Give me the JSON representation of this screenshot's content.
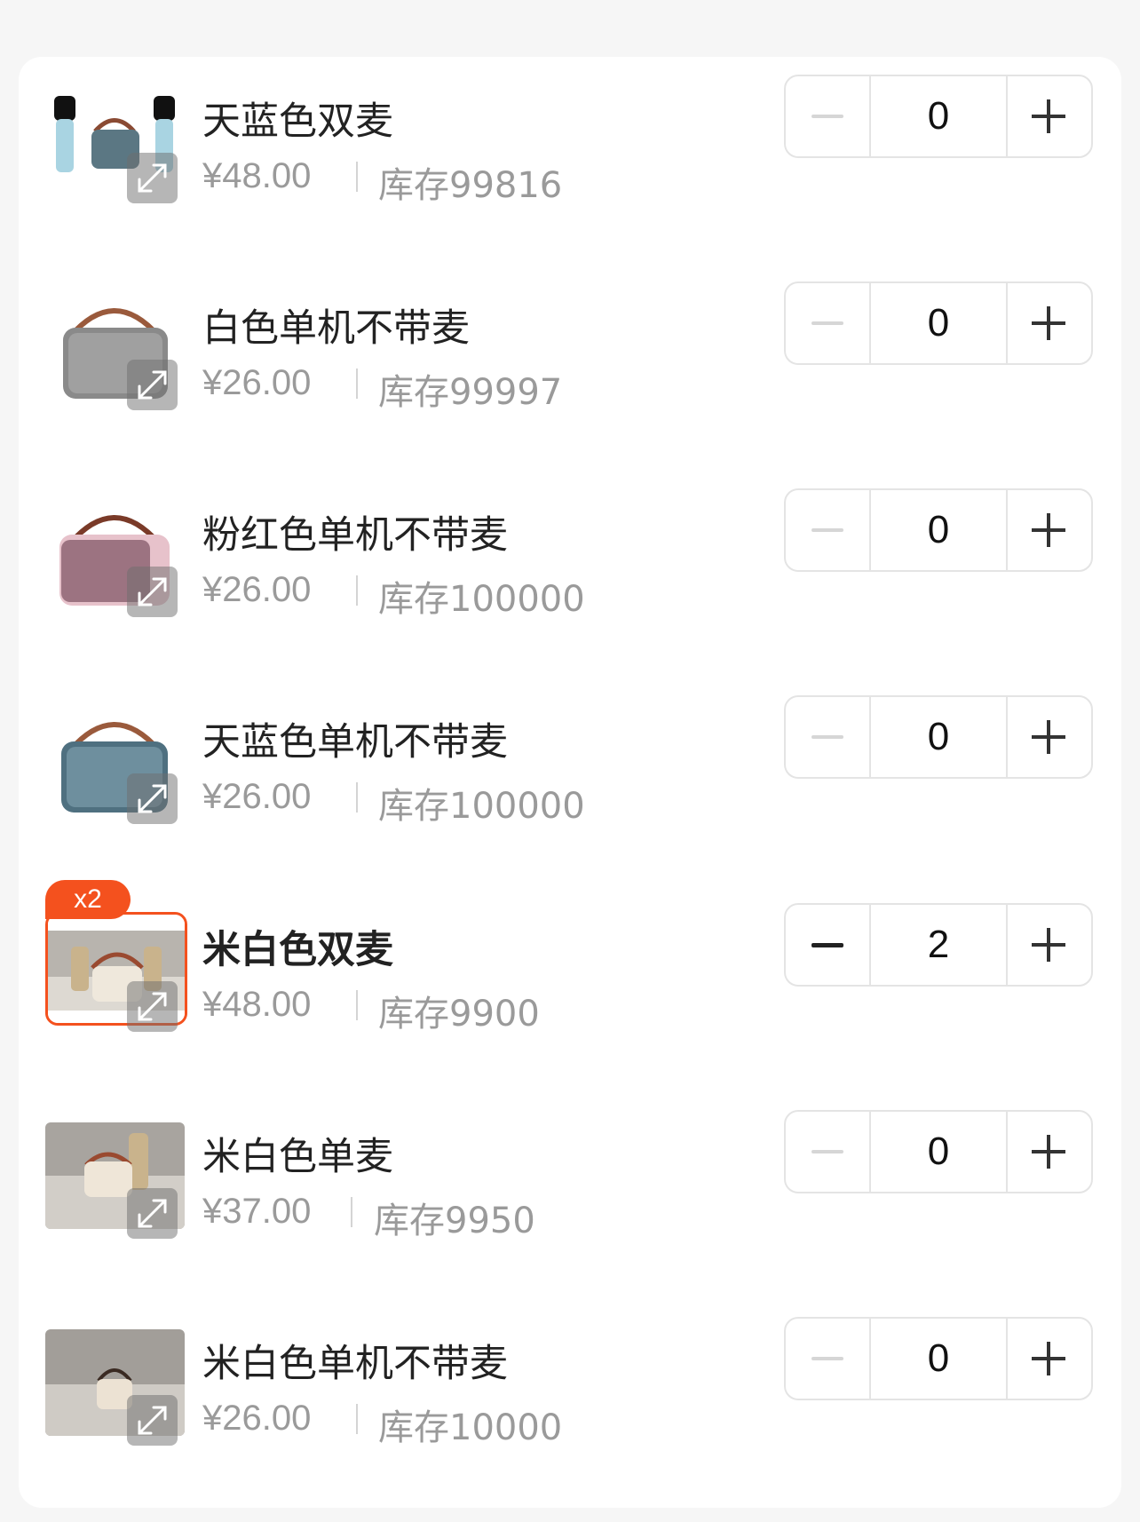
{
  "items": [
    {
      "name": "天蓝色双麦",
      "price": "¥48.00",
      "stock": "库存99816",
      "quantity": "0",
      "selected": false,
      "image": "blue-speaker-two-mics"
    },
    {
      "name": "白色单机不带麦",
      "price": "¥26.00",
      "stock": "库存99997",
      "quantity": "0",
      "selected": false,
      "image": "white-speaker"
    },
    {
      "name": "粉红色单机不带麦",
      "price": "¥26.00",
      "stock": "库存100000",
      "quantity": "0",
      "selected": false,
      "image": "pink-speaker"
    },
    {
      "name": "天蓝色单机不带麦",
      "price": "¥26.00",
      "stock": "库存100000",
      "quantity": "0",
      "selected": false,
      "image": "blue-speaker"
    },
    {
      "name": "米白色双麦",
      "price": "¥48.00",
      "stock": "库存9900",
      "quantity": "2",
      "selected": true,
      "badge": "x2",
      "image": "beige-speaker-two-mics"
    },
    {
      "name": "米白色单麦",
      "price": "¥37.00",
      "stock": "库存9950",
      "quantity": "0",
      "selected": false,
      "image": "beige-speaker-one-mic"
    },
    {
      "name": "米白色单机不带麦",
      "price": "¥26.00",
      "stock": "库存10000",
      "quantity": "0",
      "selected": false,
      "image": "beige-speaker"
    }
  ],
  "colors": {
    "accent": "#f4511e",
    "background": "#f6f6f6"
  },
  "icons": {
    "expand": "expand-icon",
    "minus": "minus-icon",
    "plus": "plus-icon"
  }
}
